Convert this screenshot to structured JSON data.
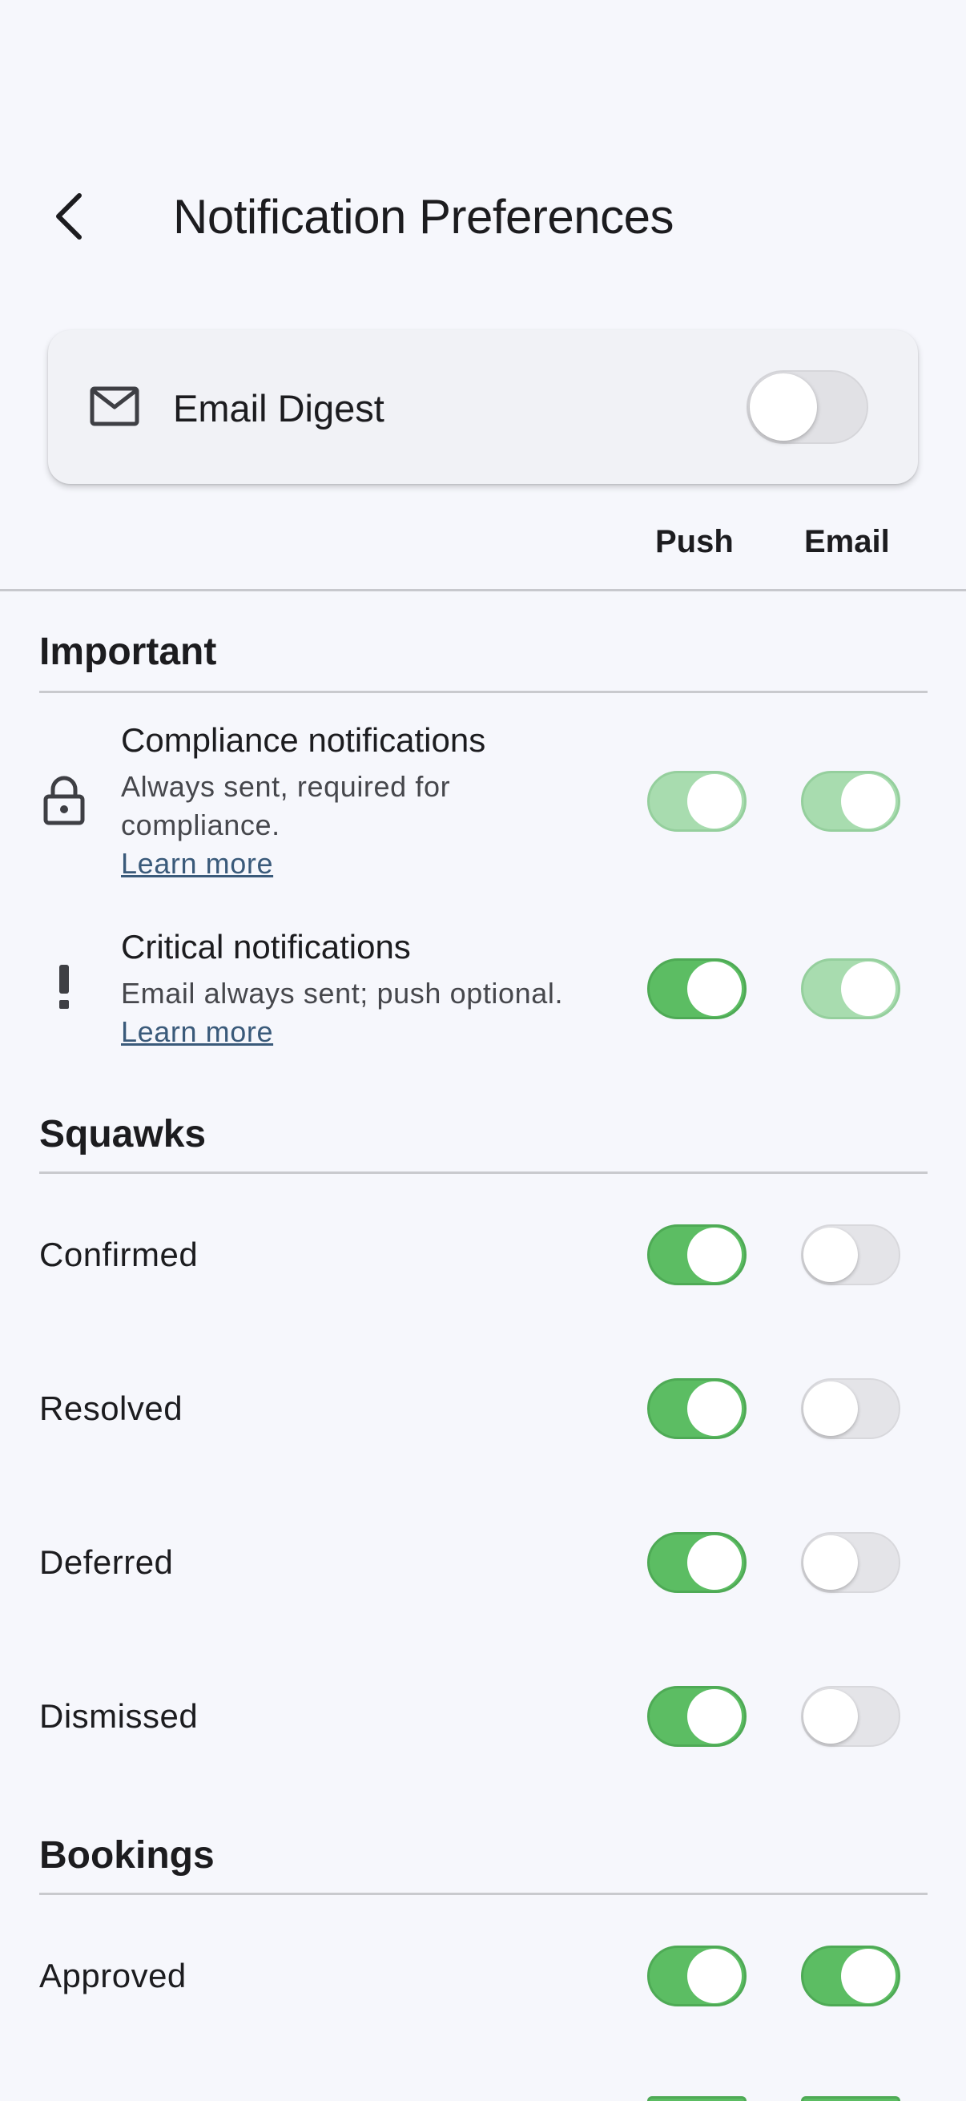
{
  "header": {
    "title": "Notification Preferences"
  },
  "digest": {
    "label": "Email Digest",
    "enabled": false
  },
  "columns": {
    "push": "Push",
    "email": "Email"
  },
  "sections": {
    "important": {
      "title": "Important",
      "compliance": {
        "title": "Compliance notifications",
        "desc": "Always sent, required for compliance.",
        "link": "Learn more",
        "push": "on-locked",
        "email": "on-locked"
      },
      "critical": {
        "title": "Critical notifications",
        "desc": "Email always sent; push optional.",
        "link": "Learn more",
        "push": "on",
        "email": "on-locked"
      }
    },
    "squawks": {
      "title": "Squawks",
      "items": [
        {
          "label": "Confirmed",
          "push": "on",
          "email": "off"
        },
        {
          "label": "Resolved",
          "push": "on",
          "email": "off"
        },
        {
          "label": "Deferred",
          "push": "on",
          "email": "off"
        },
        {
          "label": "Dismissed",
          "push": "on",
          "email": "off"
        }
      ]
    },
    "bookings": {
      "title": "Bookings",
      "items": [
        {
          "label": "Approved",
          "push": "on",
          "email": "on"
        }
      ]
    }
  },
  "colors": {
    "toggle_on": "#5cbd63",
    "toggle_locked": "#a8dcaf",
    "toggle_off": "#e4e4e8",
    "background": "#f6f7fc",
    "link": "#3a5a7a"
  },
  "icons": {
    "back": "chevron-left-icon",
    "digest": "mail-icon",
    "compliance": "lock-icon",
    "critical": "exclamation-icon"
  }
}
